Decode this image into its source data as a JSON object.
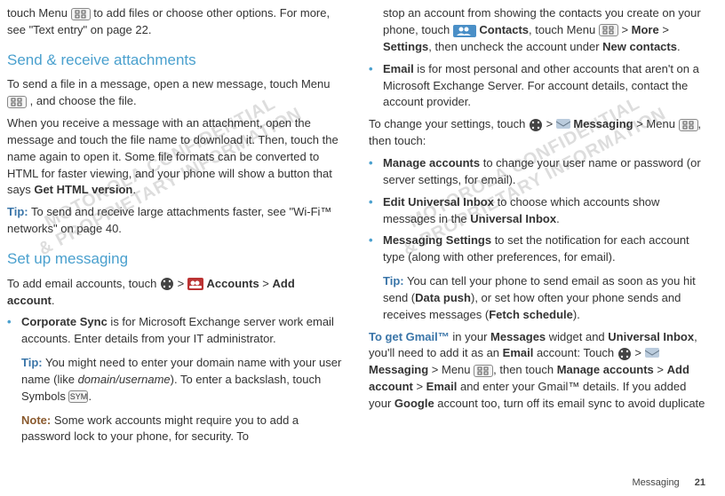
{
  "left": {
    "intro_a": "touch Menu",
    "intro_b": "to add files or choose other options. For more, see \"Text entry\" on page 22.",
    "h1": "Send & receive attachments",
    "p2a": "To send a file in a message, open a new message, touch Menu",
    "p2b": ", and choose the file.",
    "p3a": "When you receive a message with an attachment, open the message and touch the file name to download it. Then, touch the name again to open it. Some file formats can be converted to HTML for faster viewing, and your phone will show a button that says ",
    "p3b": "Get HTML version",
    "tip1_label": "Tip:",
    "tip1_text": " To send and receive large attachments faster, see \"Wi-Fi™ networks\" on page 40.",
    "h2": "Set up messaging",
    "p5a": "To add email accounts, touch ",
    "accounts_label": " Accounts",
    "p5b": "Add account",
    "b1a": "Corporate Sync",
    "b1b": " is for Microsoft Exchange server work email accounts. Enter details from your IT administrator.",
    "tip2_label": "Tip:",
    "tip2_text": " You might need to enter your domain name with your user name (like ",
    "tip2_italic": "domain/username",
    "tip2_tail": "). To enter a backslash, touch Symbols ",
    "note1_label": "Note:",
    "note1_text": " Some work accounts might require you to add a password lock to your phone, for security. To",
    "sym_label": "SYM"
  },
  "right": {
    "p1a": "stop an account from showing the contacts you create on your phone, touch ",
    "contacts_label": " Contacts",
    "p1b": ", touch Menu ",
    "more_label": "More",
    "settings_label": "Settings",
    "p1c": ", then uncheck the account under ",
    "newcontacts_label": "New contacts",
    "b2a": "Email",
    "b2b": " is for most personal and other accounts that aren't on a Microsoft Exchange Server. For account details, contact the account provider.",
    "p3a": "To change your settings, touch ",
    "messaging_label": " Messaging",
    "p3b": " > Menu ",
    "p3c": ", then touch:",
    "b3a": "Manage accounts",
    "b3b": " to change your user name or password (or server settings, for email).",
    "b4a": "Edit Universal Inbox",
    "b4b": " to choose which accounts show messages in the ",
    "b4c": "Universal Inbox",
    "b5a": "Messaging Settings",
    "b5b": " to set the notification for each account type (along with other preferences, for email).",
    "tip3_label": "Tip:",
    "tip3_text_a": " You can tell your phone to send email as soon as you hit send (",
    "tip3_bold1": "Data push",
    "tip3_text_b": "), or set how often your phone sends and receives messages (",
    "tip3_bold2": "Fetch schedule",
    "tip3_text_c": ").",
    "gmail_head": "To get Gmail™",
    "gmail_a": " in your ",
    "gmail_b1": "Messages",
    "gmail_b": " widget and ",
    "gmail_b2": "Universal Inbox",
    "gmail_c": ", you'll need to add it as an ",
    "gmail_b3": "Email",
    "gmail_d": " account: Touch ",
    "gmail_e": " > Menu ",
    "gmail_f": ", then touch ",
    "gmail_b4": "Manage accounts",
    "gmail_b5": "Add account",
    "gmail_b6": "Email",
    "gmail_g": " and enter your Gmail™ details. If you added your ",
    "gmail_b7": "Google",
    "gmail_h": " account too, turn off its email sync to avoid duplicate"
  },
  "footer": {
    "section": "Messaging",
    "page": "21"
  },
  "watermark": "MOTOROLA CONFIDENTIAL\n& PROPRIETARY INFORMATION"
}
